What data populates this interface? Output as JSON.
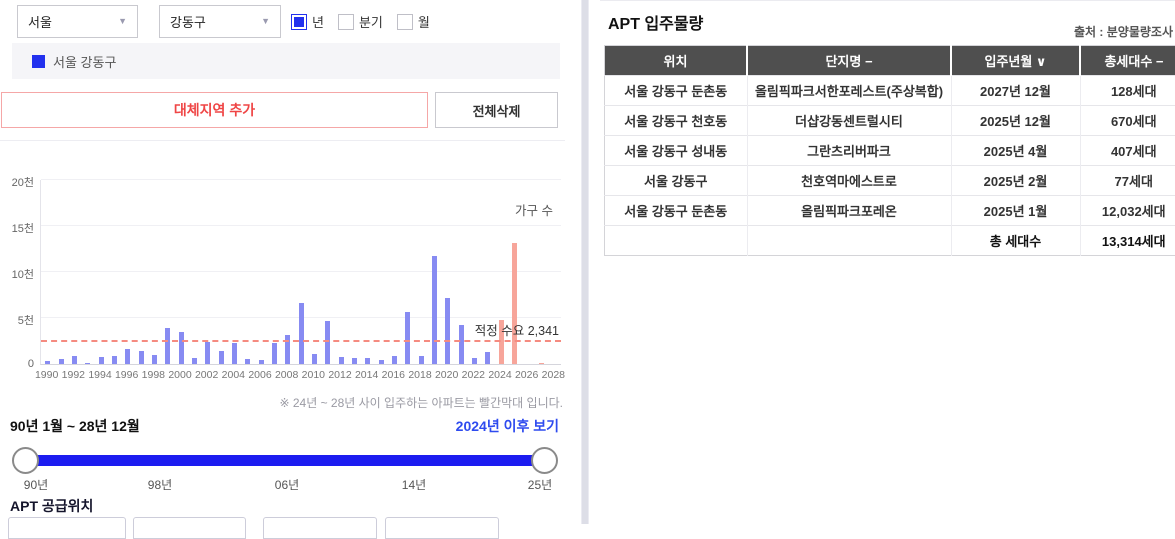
{
  "colors": {
    "accent_blue": "#2231ee",
    "slider_blue": "#1c1cf0",
    "link_blue": "#2e4bef",
    "bar_blue": "#878bf2",
    "bar_red": "#f7a59a",
    "demand_line_red": "#f58b80",
    "button_red_text": "#ef4545",
    "button_red_border": "#f5a7a7",
    "table_header_bg": "#4f4f4f"
  },
  "filters": {
    "region_select": "서울",
    "district_select": "강동구",
    "period_options": [
      {
        "label": "년",
        "checked": true
      },
      {
        "label": "분기",
        "checked": false
      },
      {
        "label": "월",
        "checked": false
      }
    ]
  },
  "legend": {
    "label": "서울 강동구"
  },
  "buttons": {
    "add_region": "대체지역 추가",
    "clear_all": "전체삭제"
  },
  "chart_data": {
    "type": "bar",
    "title": "APT 입주물량 (가구 수)",
    "unit_label": "가구 수",
    "x": [
      1990,
      1991,
      1992,
      1993,
      1994,
      1995,
      1996,
      1997,
      1998,
      1999,
      2000,
      2001,
      2002,
      2003,
      2004,
      2005,
      2006,
      2007,
      2008,
      2009,
      2010,
      2011,
      2012,
      2013,
      2014,
      2015,
      2016,
      2017,
      2018,
      2019,
      2020,
      2021,
      2022,
      2023,
      2024,
      2025,
      2026,
      2027,
      2028
    ],
    "values": [
      300,
      500,
      900,
      150,
      800,
      900,
      1600,
      1450,
      1000,
      3900,
      3500,
      600,
      2400,
      1400,
      2300,
      550,
      400,
      2300,
      3100,
      6600,
      1100,
      4700,
      800,
      650,
      700,
      400,
      850,
      5700,
      900,
      11700,
      7200,
      4200,
      700,
      1350,
      4800,
      13186,
      0,
      128,
      0
    ],
    "highlight_from_x": 2024,
    "reference_line": {
      "value": 2341,
      "label": "적정 수요 2,341"
    },
    "ylim": [
      0,
      20000
    ],
    "ytick_values": [
      0,
      5000,
      10000,
      15000,
      20000
    ],
    "ytick_labels": [
      "0",
      "5천",
      "10천",
      "15천",
      "20천"
    ],
    "xtick_step": 2,
    "legend_position": "top-right",
    "grid": true
  },
  "chart_note": "※ 24년 ~ 28년 사이 입주하는 아파트는 빨간막대 입니다.",
  "range": {
    "label": "90년 1월 ~ 28년 12월",
    "view_link": "2024년 이후 보기"
  },
  "slider": {
    "labels": [
      "90년",
      "98년",
      "06년",
      "14년",
      "25년"
    ]
  },
  "supply_section": {
    "title": "APT 공급위치"
  },
  "right_panel": {
    "title": "APT 입주물량",
    "source": "출처 : 분양물량조사",
    "table": {
      "headers": [
        "위치",
        "단지명 −",
        "입주년월 ∨",
        "총세대수 −"
      ],
      "rows": [
        [
          "서울 강동구 둔촌동",
          "올림픽파크서한포레스트(주상복합)",
          "2027년 12월",
          "128세대"
        ],
        [
          "서울 강동구 천호동",
          "더샵강동센트럴시티",
          "2025년 12월",
          "670세대"
        ],
        [
          "서울 강동구 성내동",
          "그란츠리버파크",
          "2025년 4월",
          "407세대"
        ],
        [
          "서울 강동구",
          "천호역마에스트로",
          "2025년 2월",
          "77세대"
        ],
        [
          "서울 강동구 둔촌동",
          "올림픽파크포레온",
          "2025년 1월",
          "12,032세대"
        ],
        [
          "",
          "",
          "총 세대수",
          "13,314세대"
        ]
      ]
    }
  }
}
